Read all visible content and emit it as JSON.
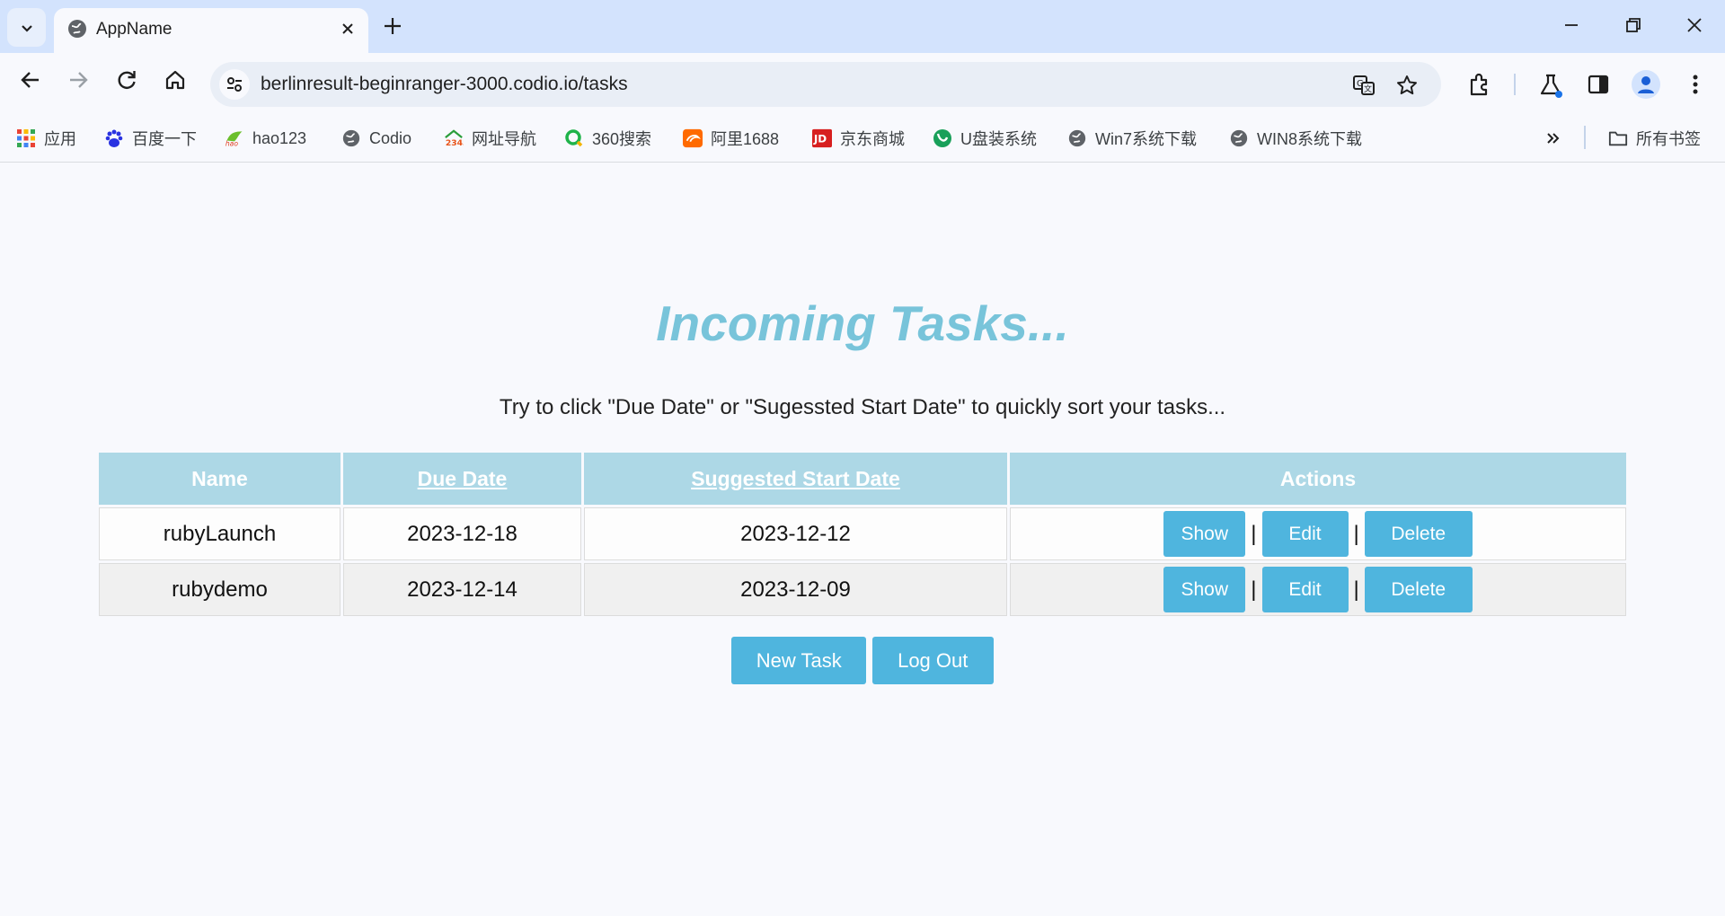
{
  "browser": {
    "tab_title": "AppName",
    "url": "berlinresult-beginranger-3000.codio.io/tasks",
    "bookmarks": [
      {
        "label": "应用",
        "icon": "apps-grid-icon"
      },
      {
        "label": "百度一下",
        "icon": "baidu-paw-icon"
      },
      {
        "label": "hao123",
        "icon": "hao123-icon"
      },
      {
        "label": "Codio",
        "icon": "globe-icon"
      },
      {
        "label": "网址导航",
        "icon": "2345-icon"
      },
      {
        "label": "360搜索",
        "icon": "360-search-icon"
      },
      {
        "label": "阿里1688",
        "icon": "ali1688-icon"
      },
      {
        "label": "京东商城",
        "icon": "jd-icon"
      },
      {
        "label": "U盘装系统",
        "icon": "u-disk-icon"
      },
      {
        "label": "Win7系统下载",
        "icon": "globe-icon"
      },
      {
        "label": "WIN8系统下载",
        "icon": "globe-icon"
      }
    ],
    "all_bookmarks": "所有书签"
  },
  "page": {
    "heading": "Incoming Tasks...",
    "hint": "Try to click \"Due Date\" or \"Sugessted Start Date\" to quickly sort your tasks...",
    "columns": {
      "name": "Name",
      "due_date": "Due Date",
      "start_date": "Suggested Start Date",
      "actions": "Actions"
    },
    "rows": [
      {
        "name": "rubyLaunch",
        "due_date": "2023-12-18",
        "start_date": "2023-12-12"
      },
      {
        "name": "rubydemo",
        "due_date": "2023-12-14",
        "start_date": "2023-12-09"
      }
    ],
    "row_actions": {
      "show": "Show",
      "edit": "Edit",
      "delete": "Delete",
      "separator": "|"
    },
    "new_task": "New Task",
    "log_out": "Log Out"
  },
  "colors": {
    "heading": "#78c4da",
    "table_header": "#add8e6",
    "button": "#4fb5de",
    "tabbar": "#d3e3fd"
  }
}
